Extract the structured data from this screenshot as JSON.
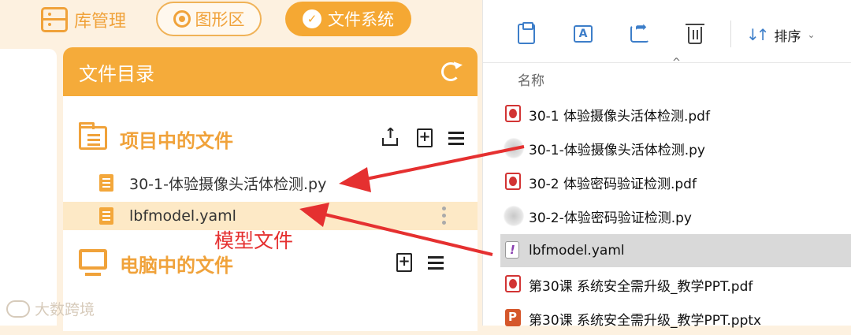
{
  "topbar": {
    "tabs": [
      {
        "label": "库管理"
      },
      {
        "label": "图形区"
      },
      {
        "label": "文件系统"
      }
    ]
  },
  "panel": {
    "title": "文件目录",
    "project_section": {
      "title": "项目中的文件",
      "files": [
        {
          "name": "30-1-体验摄像头活体检测.py"
        },
        {
          "name": "lbfmodel.yaml"
        }
      ]
    },
    "computer_section": {
      "title": "电脑中的文件"
    }
  },
  "annotation": {
    "text": "模型文件",
    "color": "#e53030"
  },
  "watermark": "大数跨境",
  "explorer": {
    "sort_label": "排序",
    "column_name": "名称",
    "files": [
      {
        "name": "30-1 体验摄像头活体检测.pdf",
        "icon": "pdf-icon"
      },
      {
        "name": "30-1-体验摄像头活体检测.py",
        "icon": "python-file-icon"
      },
      {
        "name": "30-2 体验密码验证检测.pdf",
        "icon": "pdf-icon"
      },
      {
        "name": "30-2-体验密码验证检测.py",
        "icon": "python-file-icon"
      },
      {
        "name": "lbfmodel.yaml",
        "icon": "yaml-file-icon",
        "selected": true
      },
      {
        "name": "第30课 系统安全需升级_教学PPT.pdf",
        "icon": "pdf-icon"
      },
      {
        "name": "第30课 系统安全需升级_教学PPT.pptx",
        "icon": "pptx-icon"
      }
    ]
  },
  "colors": {
    "accent": "#f5ab3a",
    "arrow": "#e53030",
    "background": "#fdf1e0"
  }
}
